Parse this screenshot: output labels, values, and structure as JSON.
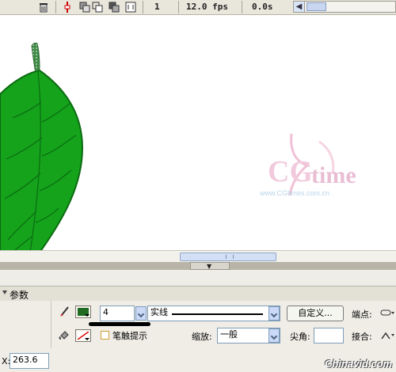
{
  "timeline": {
    "frame": "1",
    "fps": "12.0 fps",
    "time": "0.0s"
  },
  "watermark": {
    "site": "Chinavid.com"
  },
  "panel": {
    "title": "参数"
  },
  "stroke": {
    "color": "#1e6b21",
    "width_value": "4",
    "style": "实线",
    "custom_button": "自定义...",
    "cap_label": "端点:",
    "hinting_label": "笔触提示",
    "scale_label": "缩放:",
    "scale_value": "一般",
    "miter_label": "尖角:",
    "join_label": "接合:"
  },
  "position": {
    "x_label": "X:",
    "x_value": "263.6"
  },
  "colors": {
    "leaf_fill": "#14a31b",
    "leaf_stroke": "#0c6b12",
    "stem": "#3f8a47"
  },
  "icons": [
    "trash-icon",
    "onion-skin-icon",
    "onion-outline-icon",
    "edit-multiple-icon",
    "modify-markers-icon",
    "pencil-icon",
    "paint-bucket-icon",
    "no-color-icon",
    "cap-icon",
    "join-icon"
  ]
}
